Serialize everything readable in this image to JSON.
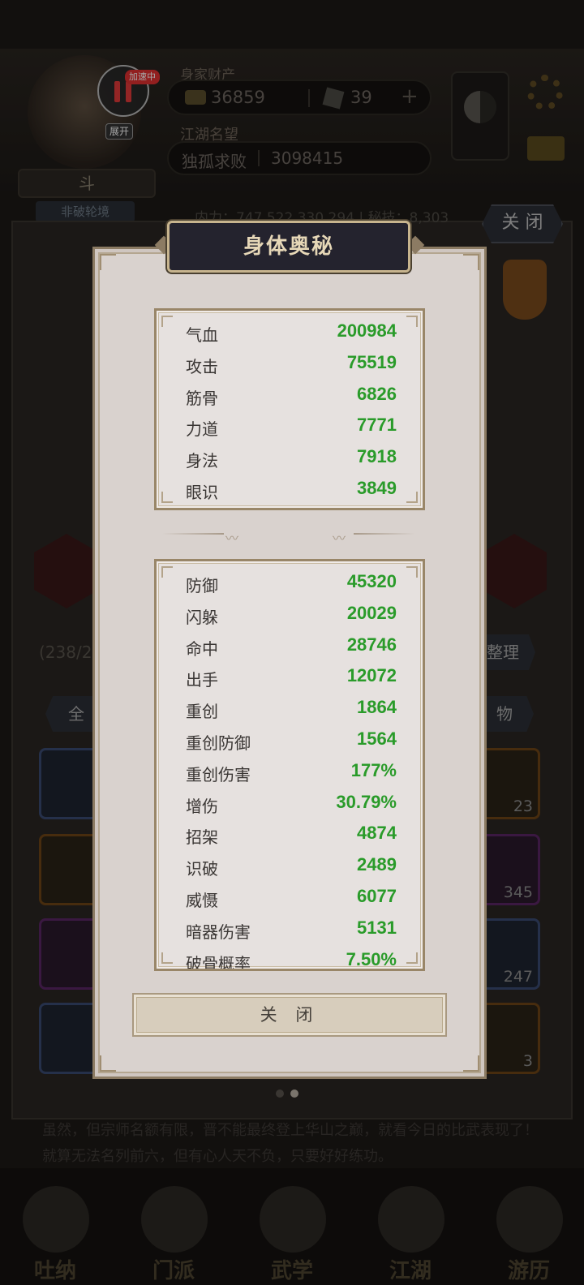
{
  "overlay": {
    "badge": "加速中",
    "expand_label": "展开"
  },
  "header": {
    "assets_label": "身家财产",
    "gold": "36859",
    "scrolls": "39",
    "plus": "+",
    "fame_label": "江湖名望",
    "title": "独孤求败",
    "fame_value": "3098415",
    "stats_line": "内力：747,522,330,294  |  秘技：8,303"
  },
  "profile": {
    "rank_glyph": "斗",
    "rank_sub": "非破轮境"
  },
  "background": {
    "close_label": "关 闭",
    "capacity_text": "(238/24",
    "sort_label": "整理",
    "filter_left": "全",
    "filter_right": "物",
    "slot_counts": [
      "23",
      "345",
      "247",
      "3"
    ],
    "story_text": "虽然，但宗师名额有限，晋不能最终登上华山之巅，就看今日的比武表现了！就算无法名列前六，但有心人天不负，只要好好练功。",
    "nav": [
      "吐纳",
      "门派",
      "武学",
      "江湖",
      "游历"
    ]
  },
  "modal": {
    "title": "身体奥秘",
    "basic_stats": [
      {
        "name": "气血",
        "value": "200984"
      },
      {
        "name": "攻击",
        "value": "75519"
      },
      {
        "name": "筋骨",
        "value": "6826"
      },
      {
        "name": "力道",
        "value": "7771"
      },
      {
        "name": "身法",
        "value": "7918"
      },
      {
        "name": "眼识",
        "value": "3849"
      }
    ],
    "advanced_stats": [
      {
        "name": "防御",
        "value": "45320"
      },
      {
        "name": "闪躲",
        "value": "20029"
      },
      {
        "name": "命中",
        "value": "28746"
      },
      {
        "name": "出手",
        "value": "12072"
      },
      {
        "name": "重创",
        "value": "1864"
      },
      {
        "name": "重创防御",
        "value": "1564"
      },
      {
        "name": "重创伤害",
        "value": "177%"
      },
      {
        "name": "增伤",
        "value": "30.79%"
      },
      {
        "name": "招架",
        "value": "4874"
      },
      {
        "name": "识破",
        "value": "2489"
      },
      {
        "name": "威慑",
        "value": "6077"
      },
      {
        "name": "暗器伤害",
        "value": "5131"
      },
      {
        "name": "破骨概率",
        "value": "7.50%"
      }
    ],
    "close_label": "关 闭"
  },
  "colors": {
    "stat_value": "#2a9b2a",
    "title_text": "#e6d7b7"
  }
}
